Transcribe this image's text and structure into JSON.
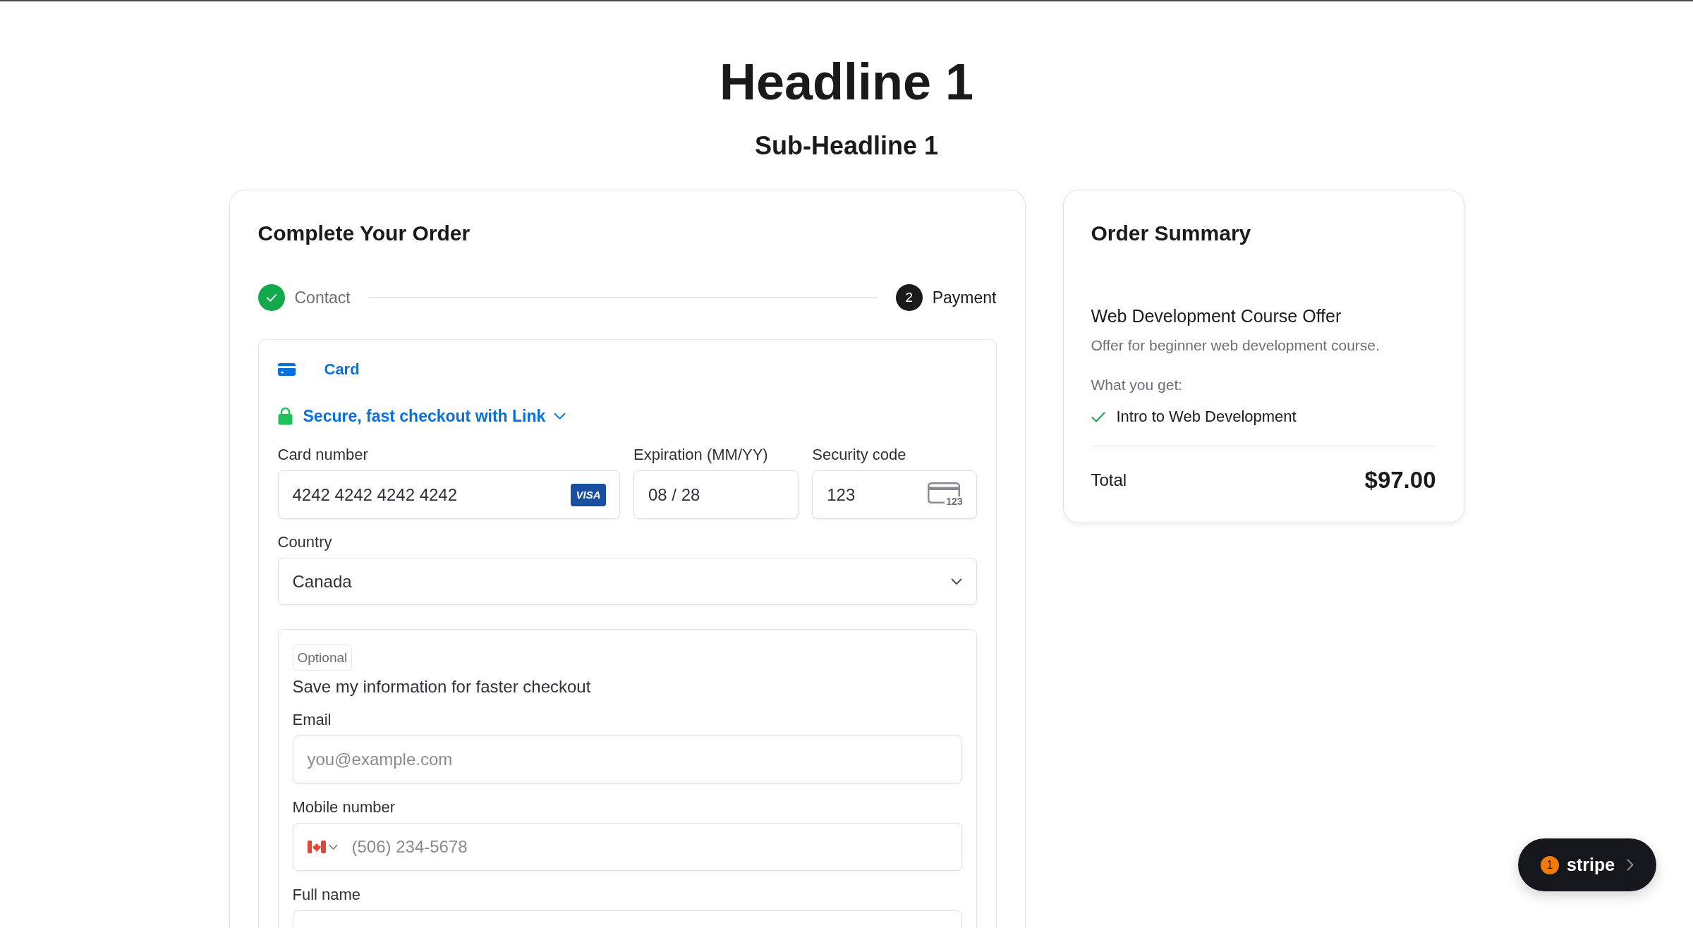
{
  "page": {
    "headline": "Headline 1",
    "subheadline": "Sub-Headline 1"
  },
  "checkout": {
    "title": "Complete Your Order",
    "steps": [
      {
        "label": "Contact",
        "completed": true,
        "selected": false
      },
      {
        "number": "2",
        "label": "Payment",
        "completed": false,
        "selected": true
      }
    ],
    "payment_methods": [
      {
        "label": "Card",
        "selected": true
      }
    ],
    "link_prompt": "Secure, fast checkout with Link",
    "card_fields": [
      {
        "kind": "card_number",
        "label": "Card number",
        "value": "4242 4242 4242 4242",
        "brand": "VISA"
      },
      {
        "kind": "expiry",
        "label": "Expiration (MM/YY)",
        "value": "08 / 28"
      },
      {
        "kind": "cvc",
        "label": "Security code",
        "value": "123",
        "icon_text": "123"
      }
    ],
    "country": {
      "label": "Country",
      "value": "Canada"
    },
    "save_info": {
      "tag": "Optional",
      "title": "Save my information for faster checkout",
      "fields": [
        {
          "kind": "email",
          "label": "Email",
          "placeholder": "you@example.com"
        },
        {
          "kind": "phone",
          "label": "Mobile number",
          "placeholder": "(506) 234-5678"
        },
        {
          "kind": "name",
          "label": "Full name"
        }
      ]
    }
  },
  "summary": {
    "title": "Order Summary",
    "product_name": "Web Development Course Offer",
    "product_description": "Offer for beginner web development course.",
    "includes_label": "What you get:",
    "includes": [
      "Intro to Web Development"
    ],
    "total_label": "Total",
    "total": "$97.00"
  },
  "stripe_badge": {
    "count": "1",
    "label": "stripe"
  }
}
